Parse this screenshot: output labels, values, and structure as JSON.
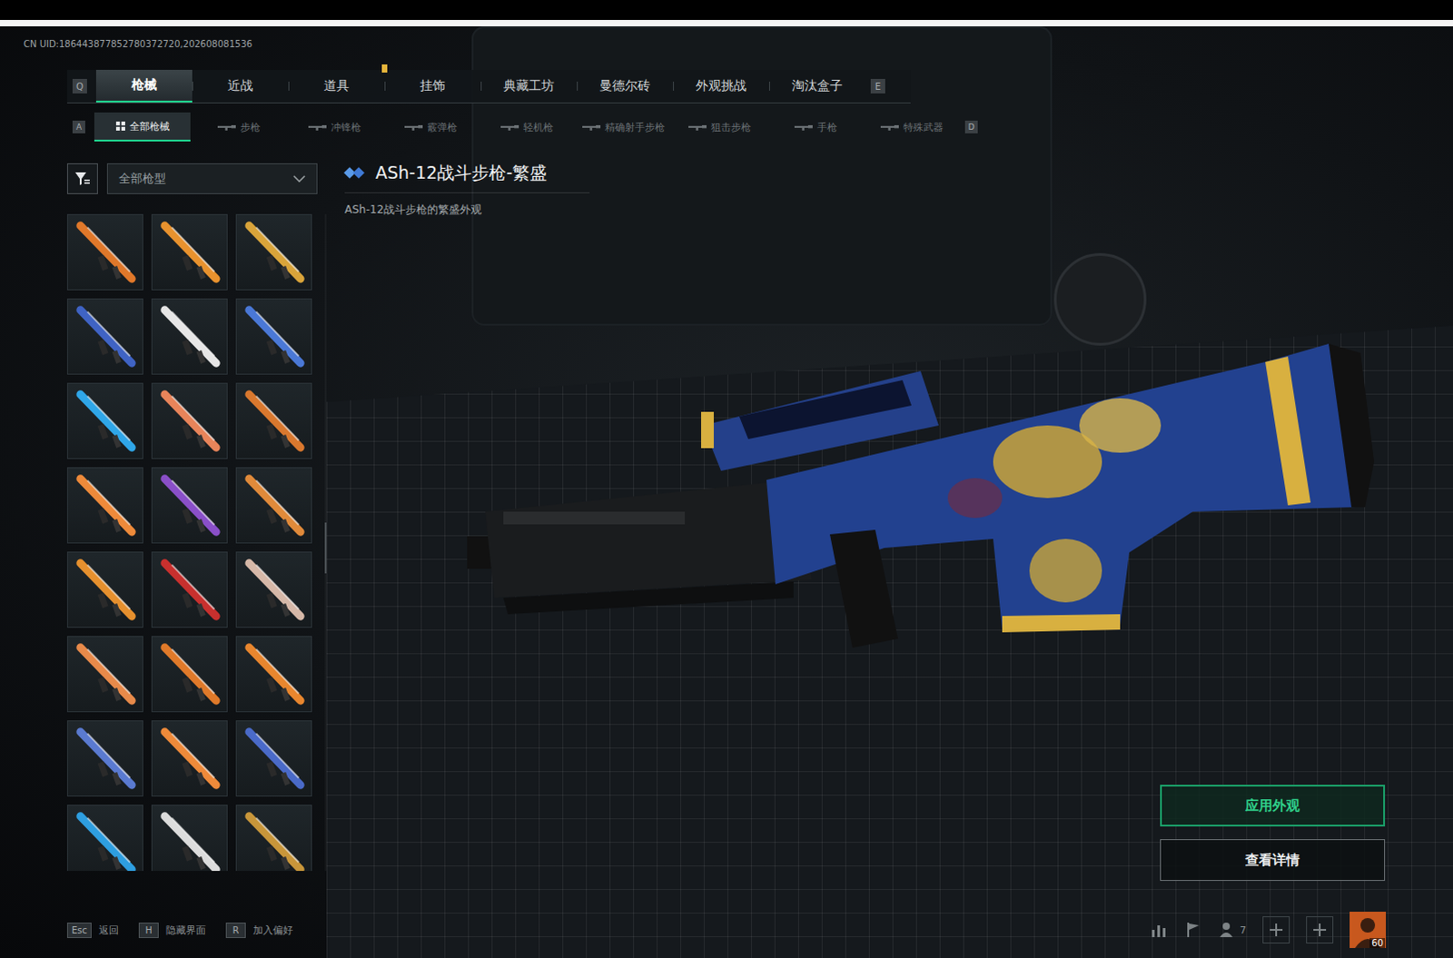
{
  "uid": "CN UID:186443877852780372720,202608081536",
  "tabs": {
    "prev_key": "Q",
    "next_key": "E",
    "items": [
      {
        "label": "枪械",
        "selected": true,
        "new": false
      },
      {
        "label": "近战",
        "selected": false,
        "new": false
      },
      {
        "label": "道具",
        "selected": false,
        "new": true
      },
      {
        "label": "挂饰",
        "selected": false,
        "new": false
      },
      {
        "label": "典藏工坊",
        "selected": false,
        "new": false
      },
      {
        "label": "曼德尔砖",
        "selected": false,
        "new": false
      },
      {
        "label": "外观挑战",
        "selected": false,
        "new": false
      },
      {
        "label": "淘汰盒子",
        "selected": false,
        "new": false
      }
    ]
  },
  "subtabs": {
    "prev_key": "A",
    "next_key": "D",
    "items": [
      {
        "label": "全部枪械",
        "selected": true,
        "kind": "all"
      },
      {
        "label": "步枪",
        "selected": false,
        "kind": "class"
      },
      {
        "label": "冲锋枪",
        "selected": false,
        "kind": "class"
      },
      {
        "label": "霰弹枪",
        "selected": false,
        "kind": "class"
      },
      {
        "label": "轻机枪",
        "selected": false,
        "kind": "class"
      },
      {
        "label": "精确射手步枪",
        "selected": false,
        "kind": "class"
      },
      {
        "label": "狙击步枪",
        "selected": false,
        "kind": "class"
      },
      {
        "label": "手枪",
        "selected": false,
        "kind": "class"
      },
      {
        "label": "特殊武器",
        "selected": false,
        "kind": "class"
      }
    ]
  },
  "filter": {
    "value": "全部枪型"
  },
  "thumbnails": [
    {
      "color": "#e0782a",
      "selected": false
    },
    {
      "color": "#e8922e",
      "selected": false
    },
    {
      "color": "#d9a43a",
      "selected": false
    },
    {
      "color": "#3f63c4",
      "selected": false
    },
    {
      "color": "#e6e6e6",
      "selected": false
    },
    {
      "color": "#4a78d6",
      "selected": false
    },
    {
      "color": "#2fa6e8",
      "selected": false
    },
    {
      "color": "#e8845a",
      "selected": false
    },
    {
      "color": "#d9782e",
      "selected": false
    },
    {
      "color": "#ee8a3a",
      "selected": false
    },
    {
      "color": "#8a4fc8",
      "selected": false
    },
    {
      "color": "#e08a3a",
      "selected": false
    },
    {
      "color": "#e6902e",
      "selected": false
    },
    {
      "color": "#c8302e",
      "selected": false
    },
    {
      "color": "#d6b8a8",
      "selected": false
    },
    {
      "color": "#e88a4a",
      "selected": false
    },
    {
      "color": "#e07a2a",
      "selected": false
    },
    {
      "color": "#e8862e",
      "selected": false
    },
    {
      "color": "#5a7ad0",
      "selected": false
    },
    {
      "color": "#ee8a3a",
      "selected": false
    },
    {
      "color": "#4a6ac8",
      "selected": false
    },
    {
      "color": "#2e9ee0",
      "selected": false
    },
    {
      "color": "#dcdcdc",
      "selected": false
    },
    {
      "color": "#c8963a",
      "selected": false
    }
  ],
  "item": {
    "title": "ASh-12战斗步枪-繁盛",
    "description": "ASh-12战斗步枪的繁盛外观"
  },
  "actions": [
    {
      "label": "应用外观",
      "kind": "primary"
    },
    {
      "label": "查看详情",
      "kind": "secondary"
    }
  ],
  "hotkeys": [
    {
      "key": "Esc",
      "label": "返回"
    },
    {
      "key": "H",
      "label": "隐藏界面"
    },
    {
      "key": "R",
      "label": "加入偏好"
    }
  ],
  "status": {
    "friends": "7",
    "level": "60"
  }
}
